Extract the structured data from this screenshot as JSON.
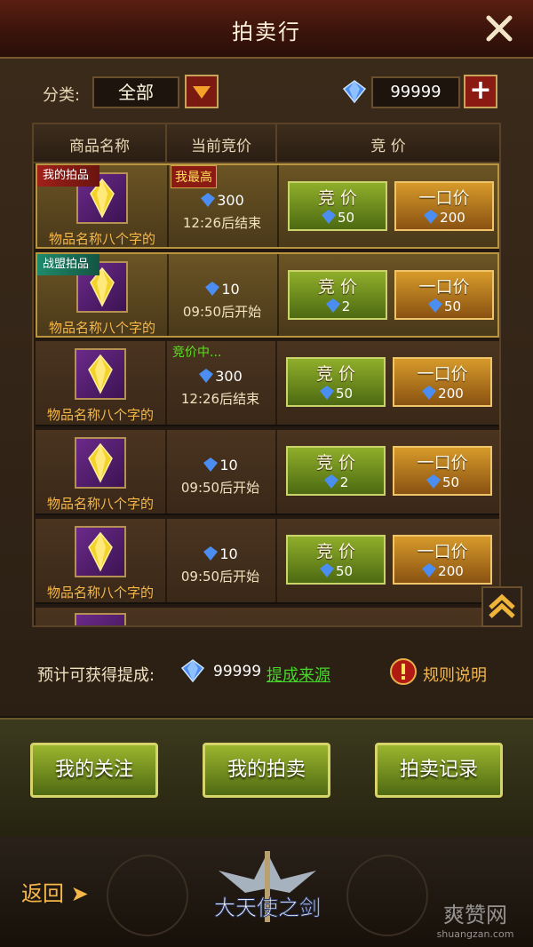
{
  "header": {
    "title": "拍卖行"
  },
  "toolbar": {
    "category_label": "分类:",
    "category_value": "全部",
    "currency_value": "99999"
  },
  "table": {
    "columns": [
      "商品名称",
      "当前竞价",
      "竞 价"
    ],
    "rows": [
      {
        "tag": "我的拍品",
        "tag_color": "red",
        "status": "我最高",
        "price": "300",
        "time": "12:26后结束",
        "bid_label": "竞 价",
        "bid_value": "50",
        "buy_label": "一口价",
        "buy_value": "200",
        "name": "物品名称八个字的",
        "highlight": true
      },
      {
        "tag": "战盟拍品",
        "tag_color": "green",
        "status": "",
        "price": "10",
        "time": "09:50后开始",
        "bid_label": "竞 价",
        "bid_value": "2",
        "buy_label": "一口价",
        "buy_value": "50",
        "name": "物品名称八个字的",
        "highlight": true
      },
      {
        "tag": "",
        "tag_color": "",
        "status": "竞价中...",
        "price": "300",
        "time": "12:26后结束",
        "bid_label": "竞 价",
        "bid_value": "50",
        "buy_label": "一口价",
        "buy_value": "200",
        "name": "物品名称八个字的",
        "highlight": false
      },
      {
        "tag": "",
        "tag_color": "",
        "status": "",
        "price": "10",
        "time": "09:50后开始",
        "bid_label": "竞 价",
        "bid_value": "2",
        "buy_label": "一口价",
        "buy_value": "50",
        "name": "物品名称八个字的",
        "highlight": false
      },
      {
        "tag": "",
        "tag_color": "",
        "status": "",
        "price": "10",
        "time": "09:50后开始",
        "bid_label": "竞 价",
        "bid_value": "50",
        "buy_label": "一口价",
        "buy_value": "200",
        "name": "物品名称八个字的",
        "highlight": false
      }
    ]
  },
  "commission": {
    "label": "预计可获得提成:",
    "value": "99999",
    "link": "提成来源",
    "rules": "规则说明"
  },
  "actions": {
    "my_watch": "我的关注",
    "my_auction": "我的拍卖",
    "auction_log": "拍卖记录"
  },
  "footer": {
    "back": "返回",
    "logo_text": "大天使之剑",
    "watermark_text": "爽赞网",
    "watermark_url": "shuangzan.com"
  },
  "colors": {
    "accent_gold": "#f5b74a",
    "bid_green": "#8fae2a",
    "buy_orange": "#d69a2a",
    "link_green": "#46d62a"
  },
  "icons": [
    "close-icon",
    "dropdown-arrow-icon",
    "diamond-icon",
    "plus-icon",
    "gem-item-icon",
    "scroll-up-icon",
    "rules-alert-icon",
    "back-arrow-icon"
  ]
}
